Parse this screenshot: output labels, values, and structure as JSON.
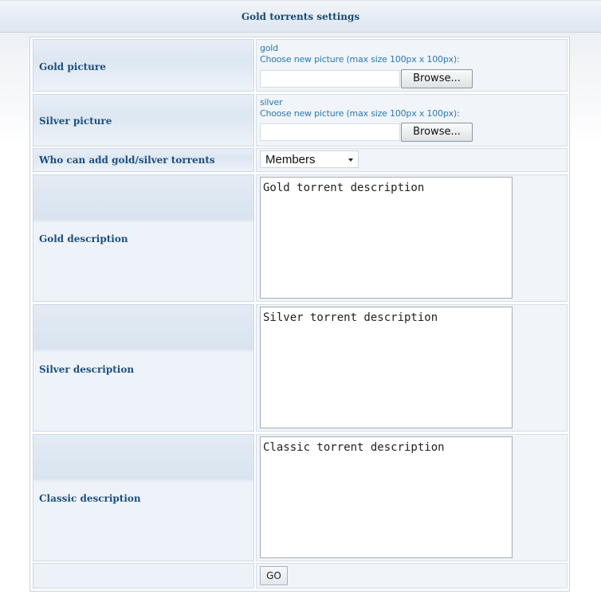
{
  "header": {
    "title": "Gold torrents settings"
  },
  "form": {
    "gold_picture": {
      "label": "Gold picture",
      "current": "gold",
      "hint": "Choose new picture (max size 100px x 100px):",
      "browse_label": "Browse..."
    },
    "silver_picture": {
      "label": "Silver picture",
      "current": "silver",
      "hint": "Choose new picture (max size 100px x 100px):",
      "browse_label": "Browse..."
    },
    "who_can_add": {
      "label": "Who can add gold/silver torrents",
      "selected": "Members"
    },
    "gold_description": {
      "label": "Gold description",
      "value": "Gold torrent description"
    },
    "silver_description": {
      "label": "Silver description",
      "value": "Silver torrent description"
    },
    "classic_description": {
      "label": "Classic description",
      "value": "Classic torrent description"
    },
    "submit_label": "GO"
  }
}
